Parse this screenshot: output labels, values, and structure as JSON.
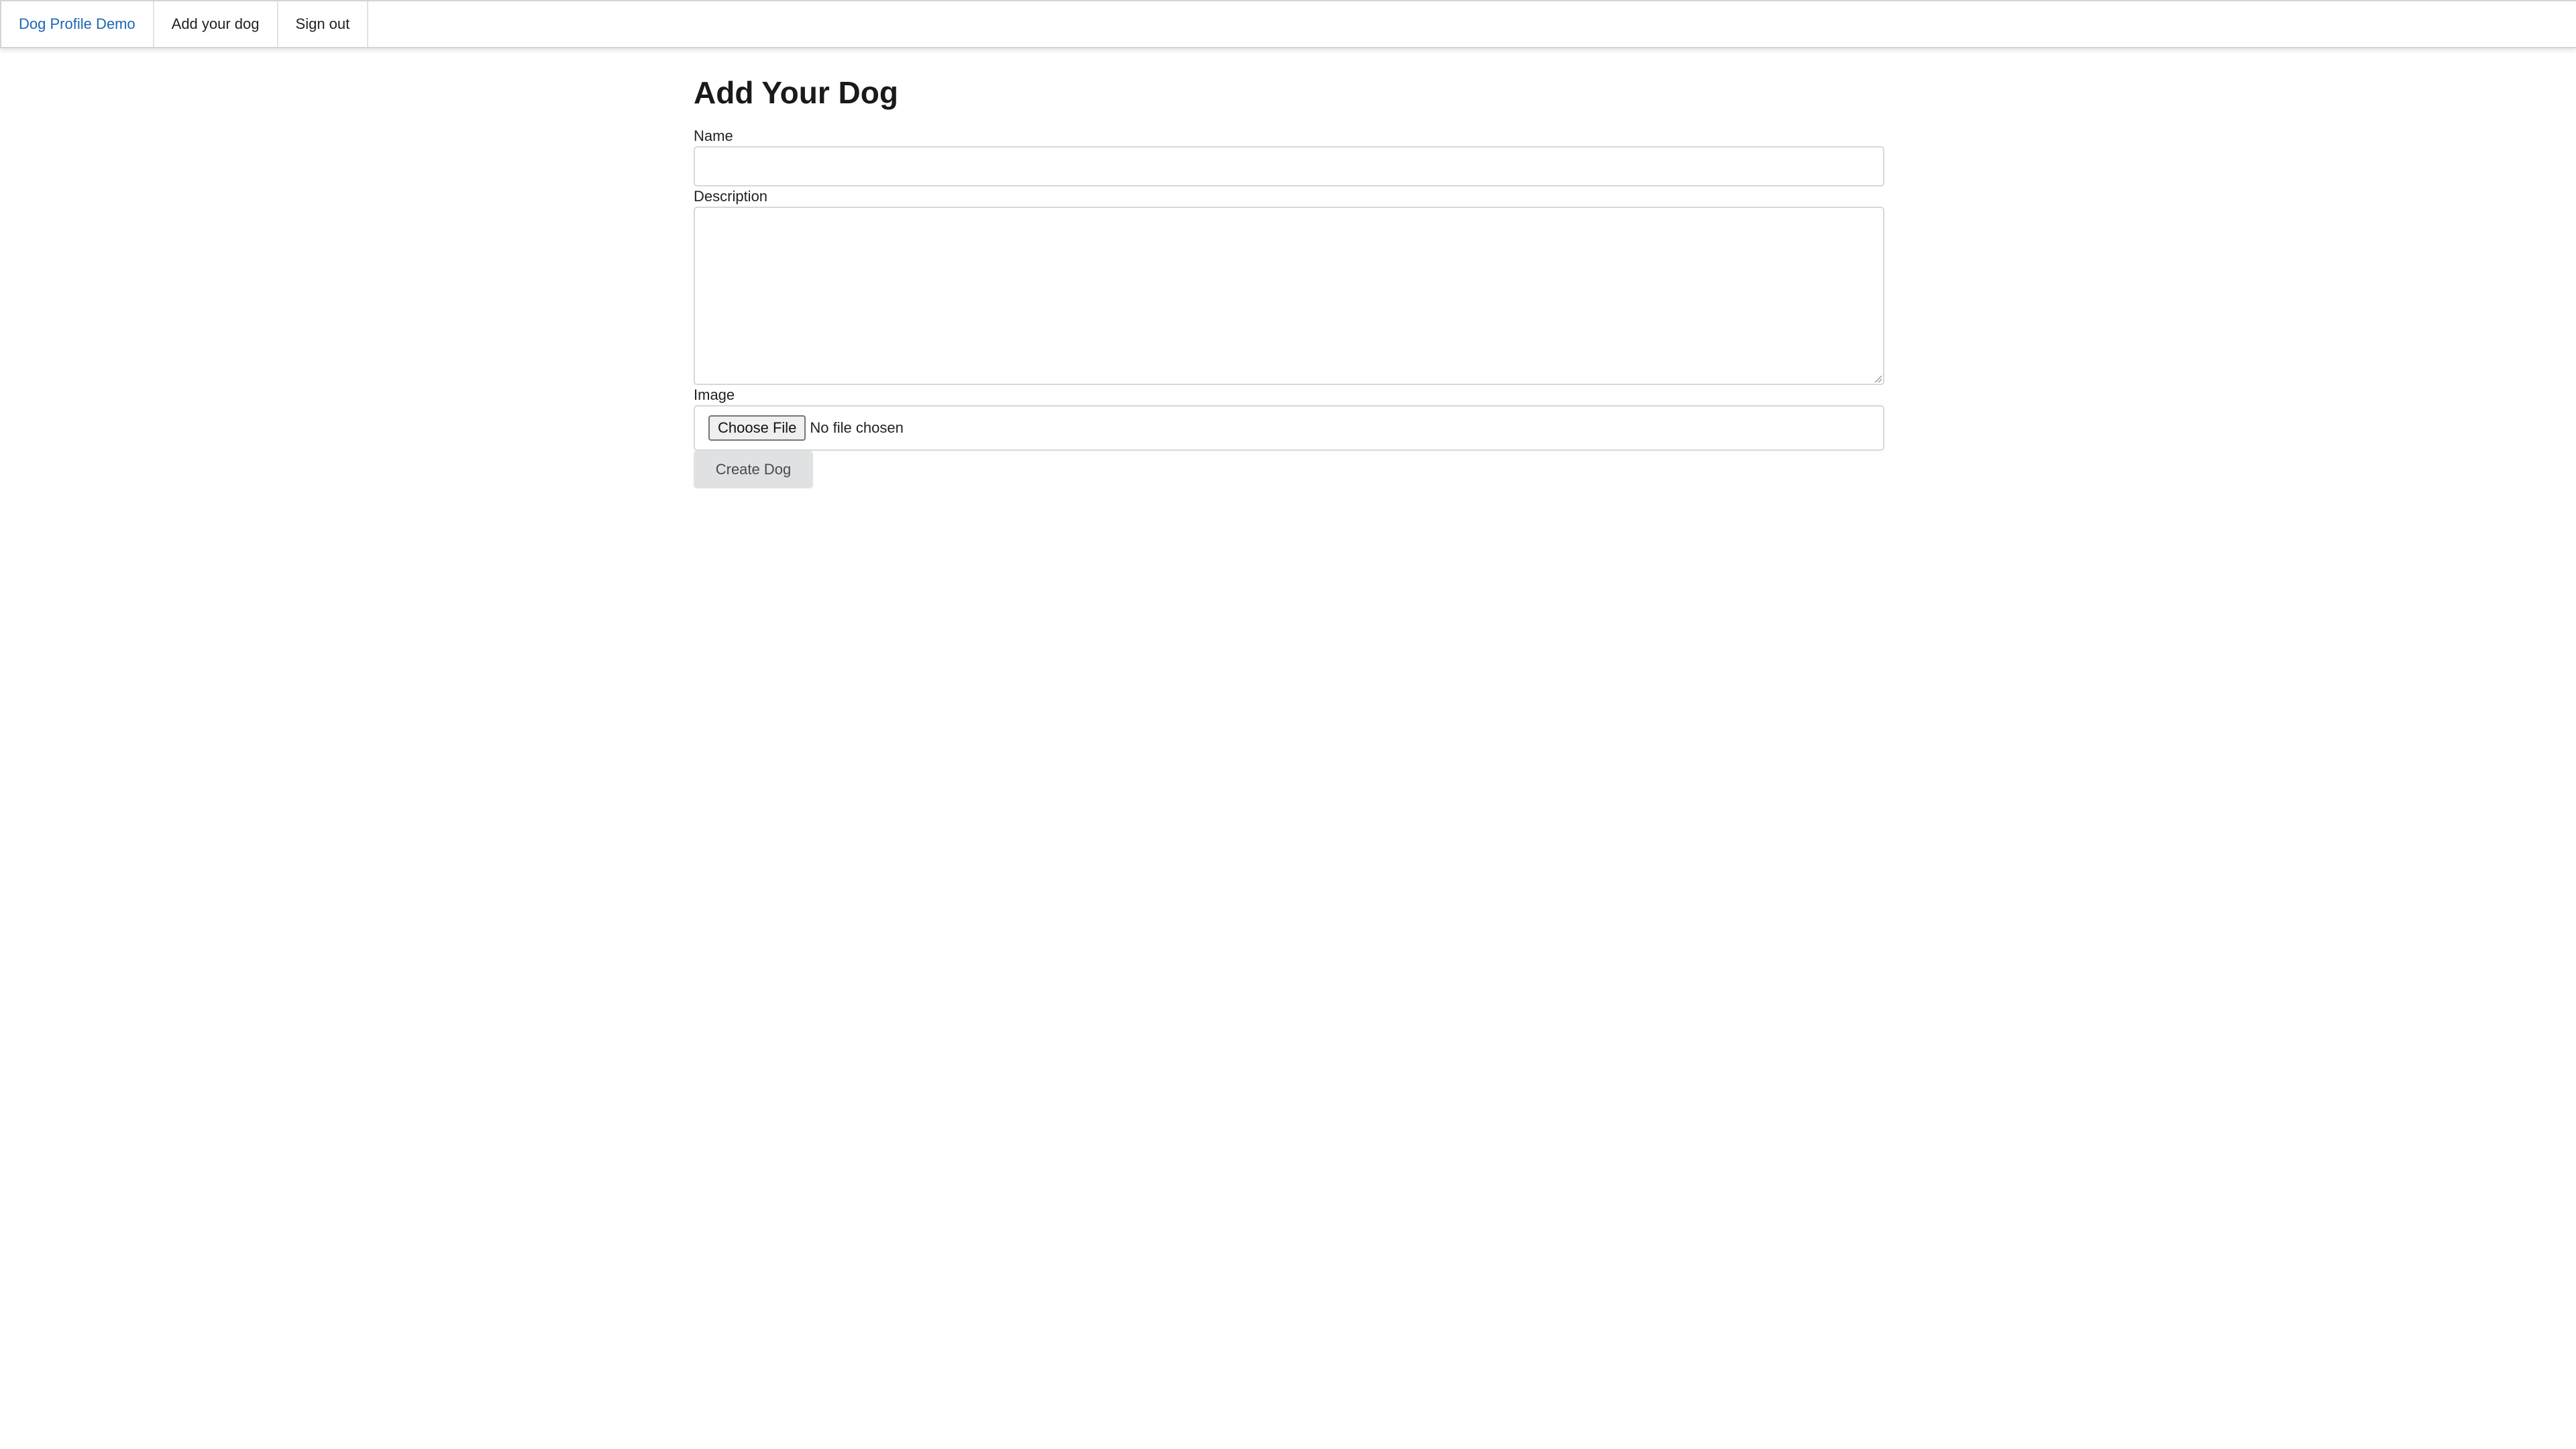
{
  "navbar": {
    "brand": "Dog Profile Demo",
    "items": [
      {
        "label": "Add your dog"
      },
      {
        "label": "Sign out"
      }
    ]
  },
  "page": {
    "title": "Add Your Dog"
  },
  "form": {
    "name": {
      "label": "Name",
      "value": ""
    },
    "description": {
      "label": "Description",
      "value": ""
    },
    "image": {
      "label": "Image",
      "button_label": "Choose File",
      "status": "No file chosen"
    },
    "submit_label": "Create Dog"
  },
  "colors": {
    "brand_link": "#1b66b3",
    "submit_button_bg": "#e0e1e2",
    "border": "#d8d8d8"
  }
}
